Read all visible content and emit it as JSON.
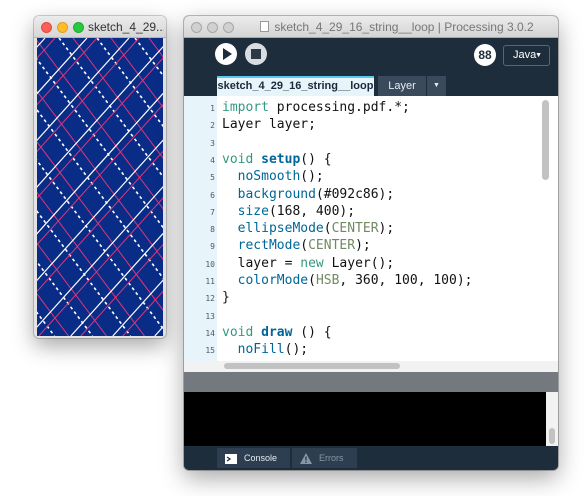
{
  "sketch_window": {
    "title": "sketch_4_29..."
  },
  "ide": {
    "title": "sketch_4_29_16_string__loop | Processing 3.0.2",
    "mode_icon": "88",
    "mode": "Java",
    "tabs": [
      "sketch_4_29_16_string__loop",
      "Layer"
    ],
    "code_lines": [
      {
        "n": "1",
        "text": "import processing.pdf.*;"
      },
      {
        "n": "2",
        "text": "Layer layer;"
      },
      {
        "n": "3",
        "text": ""
      },
      {
        "n": "4",
        "text": "void setup() {"
      },
      {
        "n": "5",
        "text": "  noSmooth();"
      },
      {
        "n": "6",
        "text": "  background(#092c86);"
      },
      {
        "n": "7",
        "text": "  size(168, 400);"
      },
      {
        "n": "8",
        "text": "  ellipseMode(CENTER);"
      },
      {
        "n": "9",
        "text": "  rectMode(CENTER);"
      },
      {
        "n": "10",
        "text": "  layer = new Layer();"
      },
      {
        "n": "11",
        "text": "  colorMode(HSB, 360, 100, 100);"
      },
      {
        "n": "12",
        "text": "}"
      },
      {
        "n": "13",
        "text": ""
      },
      {
        "n": "14",
        "text": "void draw () {"
      },
      {
        "n": "15",
        "text": "  noFill();"
      }
    ],
    "bottom_tabs": {
      "console": "Console",
      "errors": "Errors"
    }
  },
  "icons": [
    "close-dot",
    "minimize-dot",
    "zoom-dot",
    "run-icon",
    "stop-icon",
    "mode-icon",
    "dropdown-arrow-icon",
    "console-icon",
    "warning-icon",
    "document-icon"
  ],
  "colors": {
    "sketch_background": "#092c86",
    "ide_background": "#1e2d3c",
    "active_tab_accent": "#5bc6f0",
    "pattern_pink": "#e0357a",
    "pattern_white": "#ffffff"
  }
}
